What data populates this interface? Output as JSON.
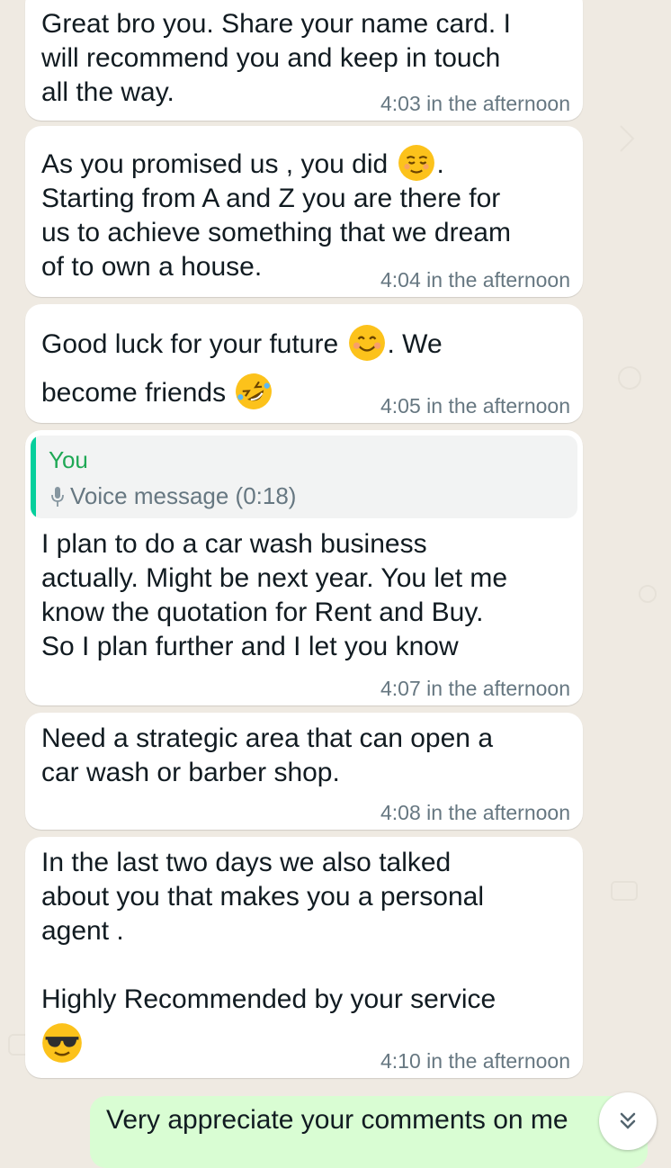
{
  "messages": [
    {
      "text": "Great bro you. Share your name card. I\nwill recommend you and keep in touch\nall the way.",
      "time": "4:03 in the afternoon"
    },
    {
      "text_a": "As you promised us , you did ",
      "emoji_a": "relieved-face",
      "text_b": ".\nStarting from A and Z you are there for\nus to achieve something that we dream\nof to own a house.",
      "time": "4:04 in the afternoon"
    },
    {
      "text_a": "Good luck for your future ",
      "emoji_a": "smiling-face",
      "text_b": ". We\nbecome friends ",
      "emoji_b": "rolling-laughing-face",
      "time": "4:05 in the afternoon"
    },
    {
      "quote_author": "You",
      "quote_text": "Voice message (0:18)",
      "quote_icon": "mic-icon",
      "text": "I plan to do a car wash business\nactually. Might be next year. You let me\nknow the quotation for Rent and Buy.\nSo I plan further and I let you know",
      "time": "4:07 in the afternoon"
    },
    {
      "text": "Need a strategic area that can open a\ncar wash or barber shop.",
      "time": "4:08 in the afternoon"
    },
    {
      "text": "In the last two days we also talked\nabout you that makes you a personal\nagent .\n\nHighly Recommended by your service",
      "emoji": "sunglasses-face",
      "time": "4:10 in the afternoon"
    }
  ],
  "outgoing_preview": {
    "text": "Very appreciate your comments on me"
  },
  "scroll_button": {
    "icon": "double-chevron-down-icon"
  },
  "colors": {
    "background": "#efeae2",
    "incoming_bubble": "#ffffff",
    "outgoing_bubble": "#d9fdd3",
    "timestamp": "#667781",
    "quote_accent": "#06cf9c",
    "quote_name": "#1fa855"
  }
}
